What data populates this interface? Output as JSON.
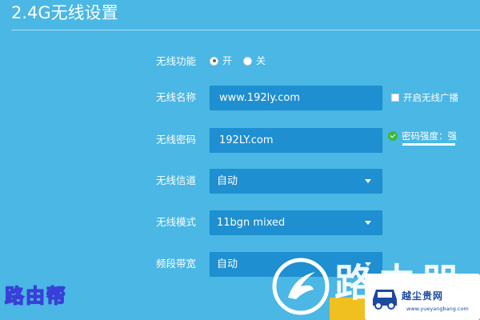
{
  "header": {
    "title": "2.4G无线设置"
  },
  "form": {
    "wireless_function": {
      "label": "无线功能",
      "options": [
        {
          "label": "开",
          "checked": true
        },
        {
          "label": "关",
          "checked": false
        }
      ]
    },
    "wireless_name": {
      "label": "无线名称",
      "value": "www.192ly.com",
      "broadcast_label": "开启无线广播",
      "broadcast_checked": false
    },
    "wireless_password": {
      "label": "无线密码",
      "value": "192LY.com",
      "strength_text": "密码强度：强"
    },
    "wireless_channel": {
      "label": "无线信道",
      "value": "自动"
    },
    "wireless_mode": {
      "label": "无线模式",
      "value": "11bgn mixed"
    },
    "bandwidth": {
      "label": "频段带宽",
      "value": "自动"
    }
  },
  "watermarks": {
    "left_text": "路由帮",
    "center_text": "路由器",
    "right_text": "越尘贵网",
    "right_url": "www.yueyangbang.com"
  },
  "colors": {
    "background": "#4ab7e4",
    "field": "#1e8fd0",
    "strength_ok": "#3cb93c",
    "save_button": "#f0c020"
  }
}
